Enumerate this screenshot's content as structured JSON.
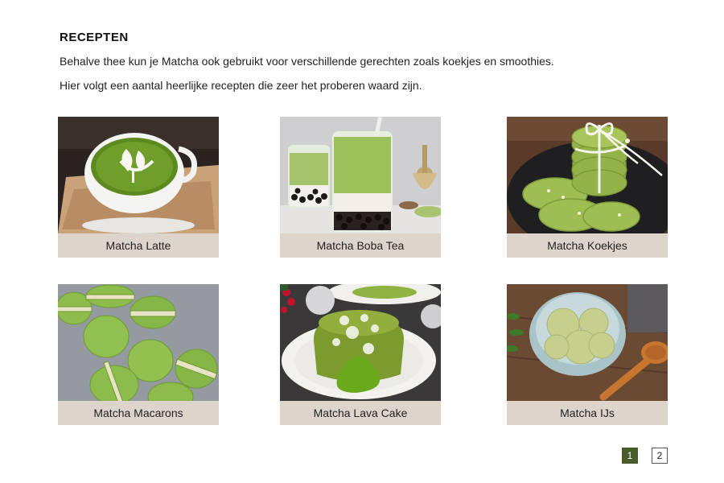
{
  "section": {
    "title": "RECEPTEN",
    "intro_line1": "Behalve thee kun je Matcha ook gebruikt voor verschillende gerechten zoals koekjes en smoothies.",
    "intro_line2": "Hier volgt een aantal heerlijke recepten die zeer het proberen waard zijn."
  },
  "recipes": [
    {
      "label": "Matcha Latte"
    },
    {
      "label": "Matcha Boba Tea"
    },
    {
      "label": "Matcha Koekjes"
    },
    {
      "label": "Matcha Macarons"
    },
    {
      "label": "Matcha Lava Cake"
    },
    {
      "label": "Matcha IJs"
    }
  ],
  "pagination": {
    "pages": [
      "1",
      "2"
    ],
    "current": "1",
    "active_color": "#4a5b2a"
  },
  "colors": {
    "label_bg": "#ddd5cb",
    "matcha_green": "#7fa83a"
  }
}
